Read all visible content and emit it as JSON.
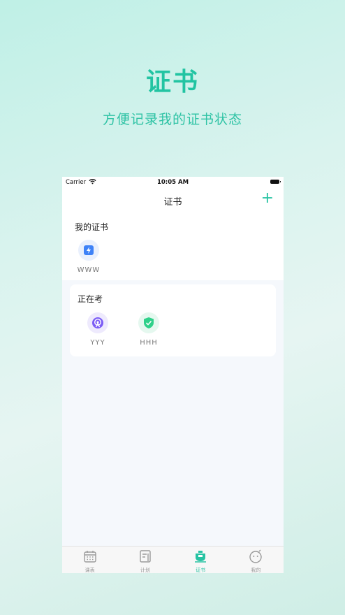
{
  "hero": {
    "title": "证书",
    "subtitle": "方便记录我的证书状态"
  },
  "status_bar": {
    "carrier": "Carrier",
    "time": "10:05 AM"
  },
  "navbar": {
    "title": "证书",
    "add_label": "+"
  },
  "my_certs": {
    "title": "我的证书",
    "items": [
      {
        "label": "WWW",
        "icon": "lightning-icon",
        "color": "#3e82f7"
      }
    ]
  },
  "in_exam": {
    "title": "正在考",
    "items": [
      {
        "label": "YYY",
        "icon": "radio-tower-icon",
        "color": "#7b5cf5"
      },
      {
        "label": "HHH",
        "icon": "shield-check-icon",
        "color": "#2fd18a"
      }
    ]
  },
  "tabbar": {
    "items": [
      {
        "label": "课表",
        "icon": "calendar-icon",
        "active": false
      },
      {
        "label": "计划",
        "icon": "plan-icon",
        "active": false
      },
      {
        "label": "证书",
        "icon": "certificate-icon",
        "active": true
      },
      {
        "label": "我的",
        "icon": "profile-face-icon",
        "active": false
      }
    ]
  },
  "colors": {
    "accent": "#27c3a3"
  }
}
